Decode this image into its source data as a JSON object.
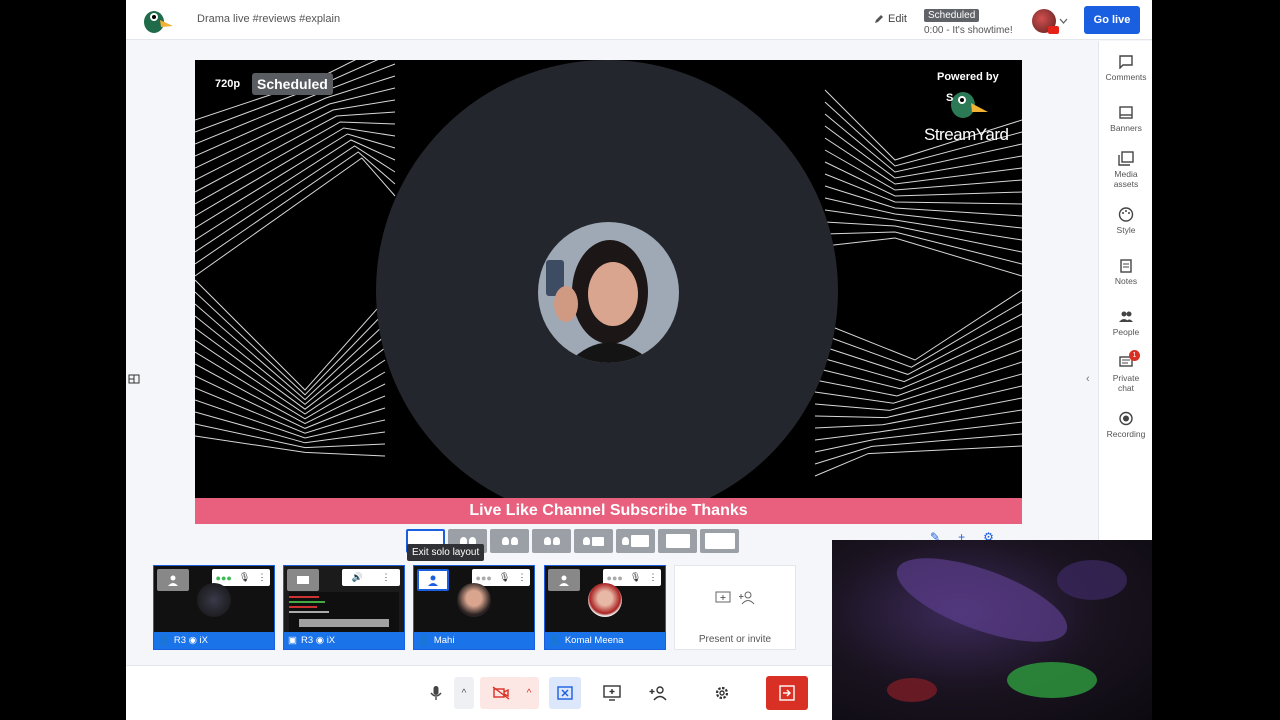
{
  "header": {
    "title": "Drama live #reviews #explain",
    "edit_label": "Edit",
    "status_badge": "Scheduled",
    "status_text": "0:00 - It's showtime!",
    "go_live_label": "Go live"
  },
  "right_panel": {
    "items": [
      {
        "label": "Comments",
        "icon": "comment-icon"
      },
      {
        "label": "Banners",
        "icon": "banner-icon"
      },
      {
        "label": "Media assets",
        "icon": "media-icon"
      },
      {
        "label": "Style",
        "icon": "palette-icon"
      },
      {
        "label": "Notes",
        "icon": "notes-icon"
      },
      {
        "label": "People",
        "icon": "people-icon"
      },
      {
        "label": "Private chat",
        "icon": "chat-icon",
        "badge": "1"
      },
      {
        "label": "Recording",
        "icon": "record-icon"
      }
    ]
  },
  "stage": {
    "resolution": "720p",
    "status_chip": "Scheduled",
    "powered_by": "Powered by",
    "brand": "StreamYard",
    "ticker": "Live Like Channel Subscribe Thanks"
  },
  "layouts": {
    "tooltip": "Exit solo layout",
    "count": 8
  },
  "tiles": [
    {
      "name": "R3 ◉ iX"
    },
    {
      "name": "R3 ◉ iX"
    },
    {
      "name": "Mahi"
    },
    {
      "name": "Komal Meena"
    }
  ],
  "present": {
    "label": "Present or invite"
  },
  "colors": {
    "accent": "#1a5fe0",
    "ticker": "#e8607e",
    "leave": "#d93025"
  }
}
